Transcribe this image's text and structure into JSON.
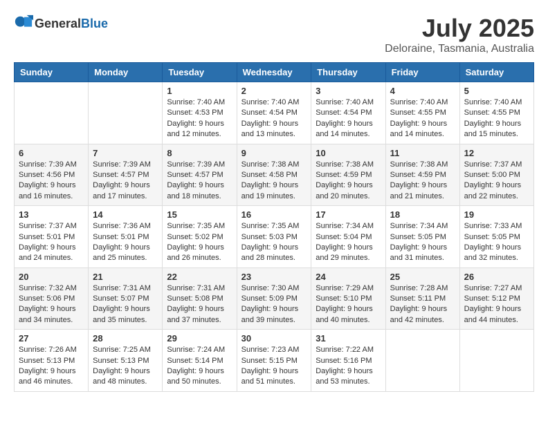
{
  "header": {
    "logo": {
      "text_general": "General",
      "text_blue": "Blue"
    },
    "month_year": "July 2025",
    "location": "Deloraine, Tasmania, Australia"
  },
  "days_of_week": [
    "Sunday",
    "Monday",
    "Tuesday",
    "Wednesday",
    "Thursday",
    "Friday",
    "Saturday"
  ],
  "weeks": [
    [
      {
        "day": "",
        "info": ""
      },
      {
        "day": "",
        "info": ""
      },
      {
        "day": "1",
        "info": "Sunrise: 7:40 AM\nSunset: 4:53 PM\nDaylight: 9 hours and 12 minutes."
      },
      {
        "day": "2",
        "info": "Sunrise: 7:40 AM\nSunset: 4:54 PM\nDaylight: 9 hours and 13 minutes."
      },
      {
        "day": "3",
        "info": "Sunrise: 7:40 AM\nSunset: 4:54 PM\nDaylight: 9 hours and 14 minutes."
      },
      {
        "day": "4",
        "info": "Sunrise: 7:40 AM\nSunset: 4:55 PM\nDaylight: 9 hours and 14 minutes."
      },
      {
        "day": "5",
        "info": "Sunrise: 7:40 AM\nSunset: 4:55 PM\nDaylight: 9 hours and 15 minutes."
      }
    ],
    [
      {
        "day": "6",
        "info": "Sunrise: 7:39 AM\nSunset: 4:56 PM\nDaylight: 9 hours and 16 minutes."
      },
      {
        "day": "7",
        "info": "Sunrise: 7:39 AM\nSunset: 4:57 PM\nDaylight: 9 hours and 17 minutes."
      },
      {
        "day": "8",
        "info": "Sunrise: 7:39 AM\nSunset: 4:57 PM\nDaylight: 9 hours and 18 minutes."
      },
      {
        "day": "9",
        "info": "Sunrise: 7:38 AM\nSunset: 4:58 PM\nDaylight: 9 hours and 19 minutes."
      },
      {
        "day": "10",
        "info": "Sunrise: 7:38 AM\nSunset: 4:59 PM\nDaylight: 9 hours and 20 minutes."
      },
      {
        "day": "11",
        "info": "Sunrise: 7:38 AM\nSunset: 4:59 PM\nDaylight: 9 hours and 21 minutes."
      },
      {
        "day": "12",
        "info": "Sunrise: 7:37 AM\nSunset: 5:00 PM\nDaylight: 9 hours and 22 minutes."
      }
    ],
    [
      {
        "day": "13",
        "info": "Sunrise: 7:37 AM\nSunset: 5:01 PM\nDaylight: 9 hours and 24 minutes."
      },
      {
        "day": "14",
        "info": "Sunrise: 7:36 AM\nSunset: 5:01 PM\nDaylight: 9 hours and 25 minutes."
      },
      {
        "day": "15",
        "info": "Sunrise: 7:35 AM\nSunset: 5:02 PM\nDaylight: 9 hours and 26 minutes."
      },
      {
        "day": "16",
        "info": "Sunrise: 7:35 AM\nSunset: 5:03 PM\nDaylight: 9 hours and 28 minutes."
      },
      {
        "day": "17",
        "info": "Sunrise: 7:34 AM\nSunset: 5:04 PM\nDaylight: 9 hours and 29 minutes."
      },
      {
        "day": "18",
        "info": "Sunrise: 7:34 AM\nSunset: 5:05 PM\nDaylight: 9 hours and 31 minutes."
      },
      {
        "day": "19",
        "info": "Sunrise: 7:33 AM\nSunset: 5:05 PM\nDaylight: 9 hours and 32 minutes."
      }
    ],
    [
      {
        "day": "20",
        "info": "Sunrise: 7:32 AM\nSunset: 5:06 PM\nDaylight: 9 hours and 34 minutes."
      },
      {
        "day": "21",
        "info": "Sunrise: 7:31 AM\nSunset: 5:07 PM\nDaylight: 9 hours and 35 minutes."
      },
      {
        "day": "22",
        "info": "Sunrise: 7:31 AM\nSunset: 5:08 PM\nDaylight: 9 hours and 37 minutes."
      },
      {
        "day": "23",
        "info": "Sunrise: 7:30 AM\nSunset: 5:09 PM\nDaylight: 9 hours and 39 minutes."
      },
      {
        "day": "24",
        "info": "Sunrise: 7:29 AM\nSunset: 5:10 PM\nDaylight: 9 hours and 40 minutes."
      },
      {
        "day": "25",
        "info": "Sunrise: 7:28 AM\nSunset: 5:11 PM\nDaylight: 9 hours and 42 minutes."
      },
      {
        "day": "26",
        "info": "Sunrise: 7:27 AM\nSunset: 5:12 PM\nDaylight: 9 hours and 44 minutes."
      }
    ],
    [
      {
        "day": "27",
        "info": "Sunrise: 7:26 AM\nSunset: 5:13 PM\nDaylight: 9 hours and 46 minutes."
      },
      {
        "day": "28",
        "info": "Sunrise: 7:25 AM\nSunset: 5:13 PM\nDaylight: 9 hours and 48 minutes."
      },
      {
        "day": "29",
        "info": "Sunrise: 7:24 AM\nSunset: 5:14 PM\nDaylight: 9 hours and 50 minutes."
      },
      {
        "day": "30",
        "info": "Sunrise: 7:23 AM\nSunset: 5:15 PM\nDaylight: 9 hours and 51 minutes."
      },
      {
        "day": "31",
        "info": "Sunrise: 7:22 AM\nSunset: 5:16 PM\nDaylight: 9 hours and 53 minutes."
      },
      {
        "day": "",
        "info": ""
      },
      {
        "day": "",
        "info": ""
      }
    ]
  ]
}
